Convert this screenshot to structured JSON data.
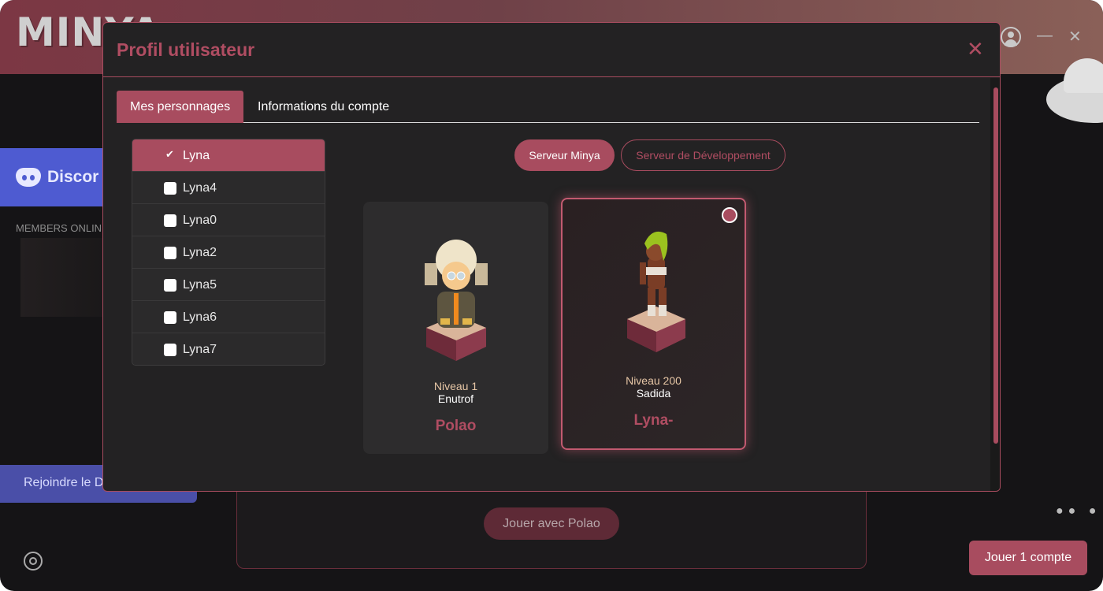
{
  "app": {
    "logo_text": "MINYA"
  },
  "window": {
    "minimize_glyph": "—",
    "close_glyph": "✕"
  },
  "sidebar": {
    "discord_label": "Discor",
    "members_online": "MEMBERS ONLINE",
    "join_button": "Rejoindre le D"
  },
  "main": {
    "play_with": "Jouer avec Polao",
    "play_account": "Jouer 1 compte"
  },
  "modal": {
    "title": "Profil utilisateur",
    "close_glyph": "✕",
    "tabs": [
      {
        "label": "Mes personnages",
        "active": true
      },
      {
        "label": "Informations du compte",
        "active": false
      }
    ],
    "characters": [
      {
        "name": "Lyna",
        "selected": true
      },
      {
        "name": "Lyna4",
        "selected": false
      },
      {
        "name": "Lyna0",
        "selected": false
      },
      {
        "name": "Lyna2",
        "selected": false
      },
      {
        "name": "Lyna5",
        "selected": false
      },
      {
        "name": "Lyna6",
        "selected": false
      },
      {
        "name": "Lyna7",
        "selected": false
      }
    ],
    "servers": [
      {
        "label": "Serveur Minya",
        "active": true
      },
      {
        "label": "Serveur de Développement",
        "active": false
      }
    ],
    "cards": [
      {
        "level": "Niveau 1",
        "class": "Enutrof",
        "name": "Polao",
        "selected": false
      },
      {
        "level": "Niveau 200",
        "class": "Sadida",
        "name": "Lyna-",
        "selected": true
      }
    ]
  },
  "colors": {
    "accent": "#a84c5f",
    "accent_text": "#b04d62",
    "modal_bg": "#232223",
    "discord": "#4e5bd1"
  }
}
